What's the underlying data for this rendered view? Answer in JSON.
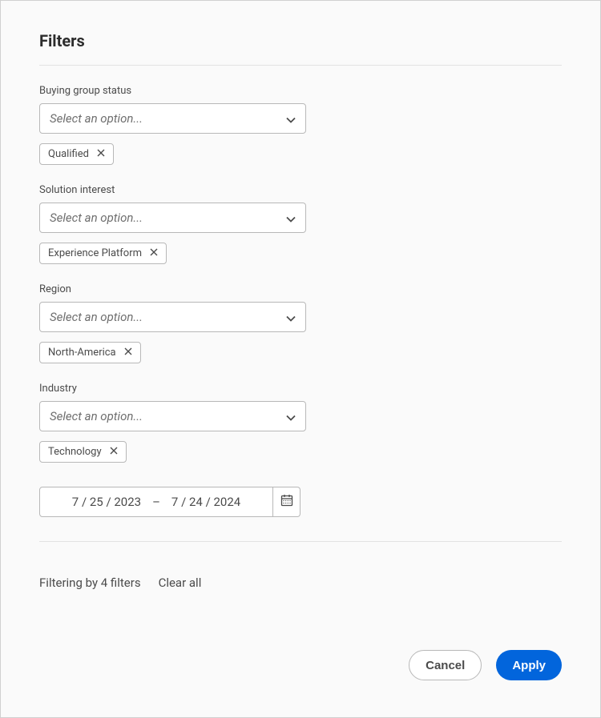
{
  "title": "Filters",
  "fields": [
    {
      "label": "Buying group status",
      "placeholder": "Select an option...",
      "tag": "Qualified"
    },
    {
      "label": "Solution interest",
      "placeholder": "Select an option...",
      "tag": "Experience Platform"
    },
    {
      "label": "Region",
      "placeholder": "Select an option...",
      "tag": "North-America"
    },
    {
      "label": "Industry",
      "placeholder": "Select an option...",
      "tag": "Technology"
    }
  ],
  "dateRange": {
    "start": "7 / 25 / 2023",
    "end": "7 / 24 / 2024",
    "dash": "–"
  },
  "summary": "Filtering by 4 filters",
  "clearAll": "Clear all",
  "buttons": {
    "cancel": "Cancel",
    "apply": "Apply"
  }
}
